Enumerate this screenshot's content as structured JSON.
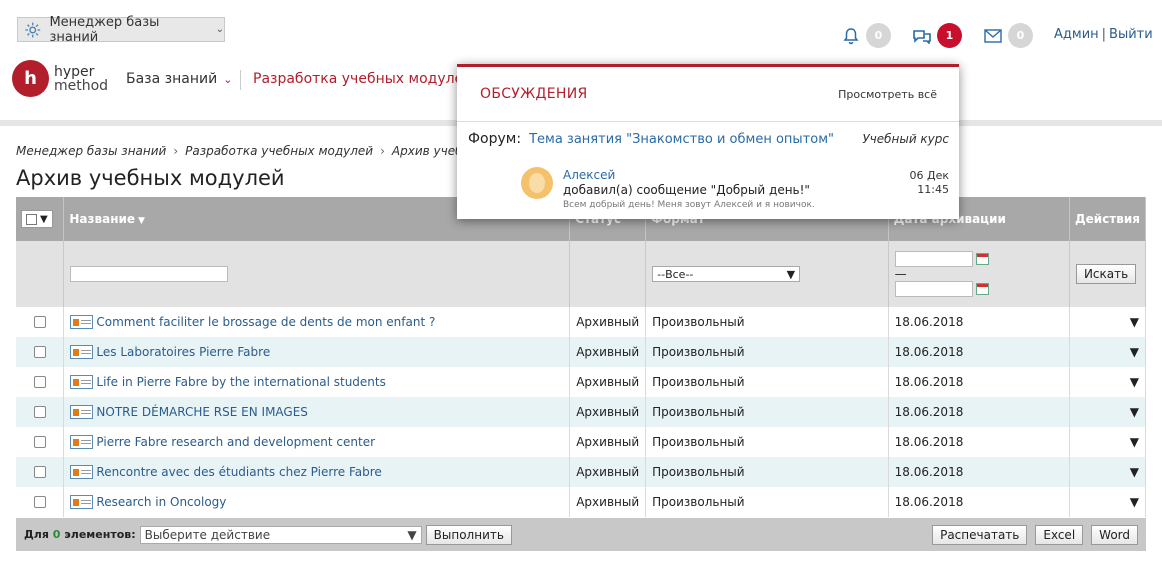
{
  "topbar": {
    "kb_manager_label": "Менеджер базы знаний",
    "notifications_count": "0",
    "discussions_count": "1",
    "messages_count": "0",
    "user_name": "Админ",
    "logout_label": "Выйти"
  },
  "logo": {
    "line1": "hyper",
    "line2": "method",
    "mark": "h"
  },
  "nav": {
    "kb_label": "База знаний",
    "section_label": "Разработка учебных модулей"
  },
  "breadcrumb": [
    "Менеджер базы знаний",
    "Разработка учебных модулей",
    "Архив учебных мод"
  ],
  "page_title": "Архив учебных модулей",
  "table": {
    "headers": {
      "name": "Название",
      "status": "Статус",
      "format": "Формат",
      "archive_date": "Дата архивации",
      "actions": "Действия"
    },
    "filter": {
      "format_selected": "--Все--",
      "date_separator": "—",
      "search_button": "Искать"
    },
    "rows": [
      {
        "title": "Comment faciliter le brossage de dents de mon enfant ?",
        "status": "Архивный",
        "format": "Произвольный",
        "date": "18.06.2018"
      },
      {
        "title": "Les Laboratoires Pierre Fabre",
        "status": "Архивный",
        "format": "Произвольный",
        "date": "18.06.2018"
      },
      {
        "title": "Life in Pierre Fabre by the international students",
        "status": "Архивный",
        "format": "Произвольный",
        "date": "18.06.2018"
      },
      {
        "title": "NOTRE DÉMARCHE RSE EN IMAGES",
        "status": "Архивный",
        "format": "Произвольный",
        "date": "18.06.2018"
      },
      {
        "title": "Pierre Fabre research and development center",
        "status": "Архивный",
        "format": "Произвольный",
        "date": "18.06.2018"
      },
      {
        "title": "Rencontre avec des étudiants chez Pierre Fabre",
        "status": "Архивный",
        "format": "Произвольный",
        "date": "18.06.2018"
      },
      {
        "title": "Research in Oncology",
        "status": "Архивный",
        "format": "Произвольный",
        "date": "18.06.2018"
      }
    ]
  },
  "footer": {
    "for_label": "Для",
    "count": "0",
    "elements_label": "элементов:",
    "action_placeholder": "Выберите действие",
    "execute_button": "Выполнить",
    "print_button": "Распечатать",
    "excel_button": "Excel",
    "word_button": "Word"
  },
  "popup": {
    "title": "ОБСУЖДЕНИЯ",
    "view_all": "Просмотреть всё",
    "forum_label": "Форум:",
    "topic": "Тема занятия \"Знакомство и обмен опытом\"",
    "course": "Учебный курс",
    "user": "Алексей",
    "action_text": "добавил(а) сообщение \"Добрый день!\"",
    "preview": "Всем добрый день! Меня зовут Алексей и я новичок.",
    "date": "06 Дек",
    "time": "11:45"
  }
}
